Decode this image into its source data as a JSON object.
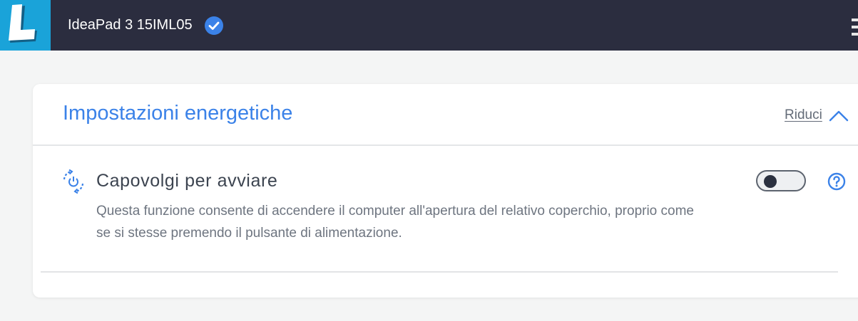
{
  "header": {
    "device_name": "IdeaPad 3 15IML05",
    "logo_letter": "L",
    "logo_color": "#1aa3d9",
    "bar_color": "#2b2d3f",
    "verified_icon": "check-badge-icon",
    "menu_icon": "more-vertical-icon"
  },
  "section": {
    "title": "Impostazioni energetiche",
    "collapse_label": "Riduci",
    "collapse_icon": "chevron-up-icon",
    "accent_color": "#3b82e8"
  },
  "feature": {
    "icon": "flip-power-icon",
    "title": "Capovolgi per avviare",
    "description": "Questa funzione consente di accendere il computer all'apertura del relativo coperchio, proprio come se si stesse premendo il pulsante di alimentazione.",
    "toggle_on": false,
    "help_icon": "help-circle-icon"
  }
}
